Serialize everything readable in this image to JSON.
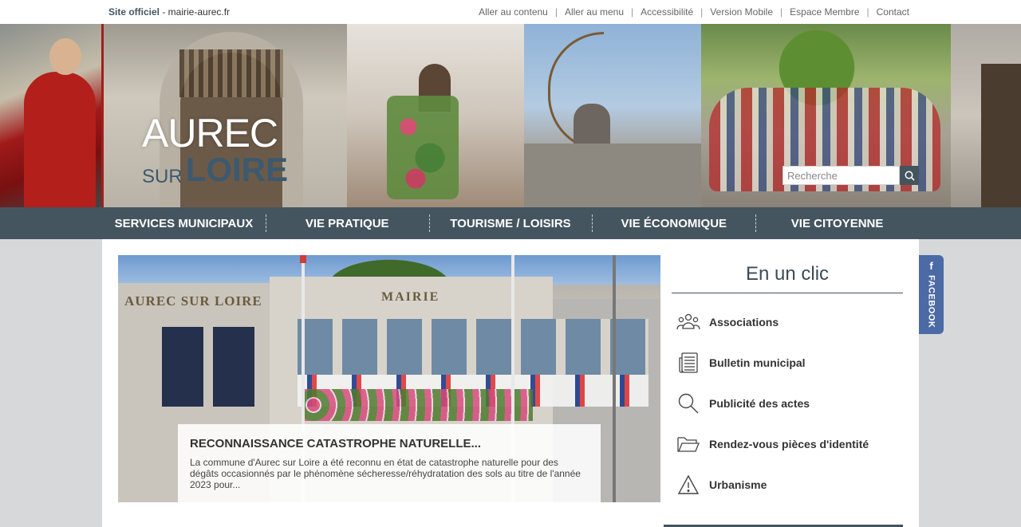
{
  "topbar": {
    "site_label": "Site officiel",
    "site_domain": " - mairie-aurec.fr",
    "links": [
      "Aller au contenu",
      "Aller au menu",
      "Accessibilité",
      "Version Mobile",
      "Espace Membre",
      "Contact"
    ]
  },
  "logo": {
    "top": "AUREC",
    "sur": "SUR",
    "loire": "LOIRE"
  },
  "search": {
    "placeholder": "Recherche"
  },
  "nav": {
    "items": [
      "SERVICES MUNICIPAUX",
      "VIE PRATIQUE",
      "TOURISME / LOISIRS",
      "VIE ÉCONOMIQUE",
      "VIE CITOYENNE"
    ]
  },
  "slide": {
    "building_sign_left": "AUREC SUR LOIRE",
    "building_sign_center": "MAIRIE",
    "title": "RECONNAISSANCE CATASTROPHE NATURELLE...",
    "text": "La commune d'Aurec sur Loire a été reconnu en état de catastrophe naturelle pour des dégâts occasionnés par le phénomène sécheresse/réhydratation des sols au titre de l'année 2023 pour..."
  },
  "clic": {
    "title": "En un clic",
    "items": [
      {
        "label": "Associations",
        "icon": "people-icon"
      },
      {
        "label": "Bulletin municipal",
        "icon": "newspaper-icon"
      },
      {
        "label": "Publicité des actes",
        "icon": "search-icon"
      },
      {
        "label": "Rendez-vous pièces d'identité",
        "icon": "folder-icon"
      },
      {
        "label": "Urbanisme",
        "icon": "warning-icon"
      }
    ]
  },
  "facebook": {
    "f": "f",
    "label": "FACEBOOK"
  },
  "colors": {
    "nav": "#455560",
    "accent": "#3c5970",
    "facebook": "#4b6aa6"
  }
}
